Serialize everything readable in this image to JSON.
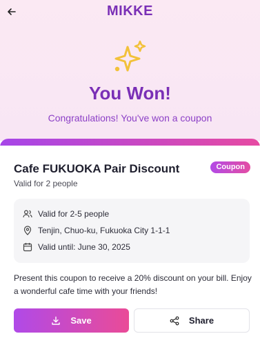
{
  "header": {
    "app_title": "MIKKE",
    "back_icon": "arrow-left-icon"
  },
  "hero": {
    "icon": "sparkles-icon",
    "title": "You Won!",
    "subtitle": "Congratulations! You've won a coupon"
  },
  "coupon": {
    "title": "Cafe FUKUOKA Pair Discount",
    "badge": "Coupon",
    "valid_for": "Valid for 2 people",
    "details": [
      {
        "icon": "users-icon",
        "text": "Valid for 2-5 people"
      },
      {
        "icon": "map-pin-icon",
        "text": "Tenjin, Chuo-ku, Fukuoka City 1-1-1"
      },
      {
        "icon": "calendar-icon",
        "text": "Valid until: June 30, 2025"
      }
    ],
    "description": "Present this coupon to receive a 20% discount on your bill. Enjoy a wonderful cafe time with your friends!"
  },
  "actions": {
    "save_label": "Save",
    "save_icon": "download-icon",
    "share_label": "Share",
    "share_icon": "share-icon"
  },
  "colors": {
    "brand_purple": "#7a2fb6",
    "gradient_start": "#a646e8",
    "gradient_end": "#e64aa2",
    "sparkle_yellow": "#f2c13a"
  }
}
